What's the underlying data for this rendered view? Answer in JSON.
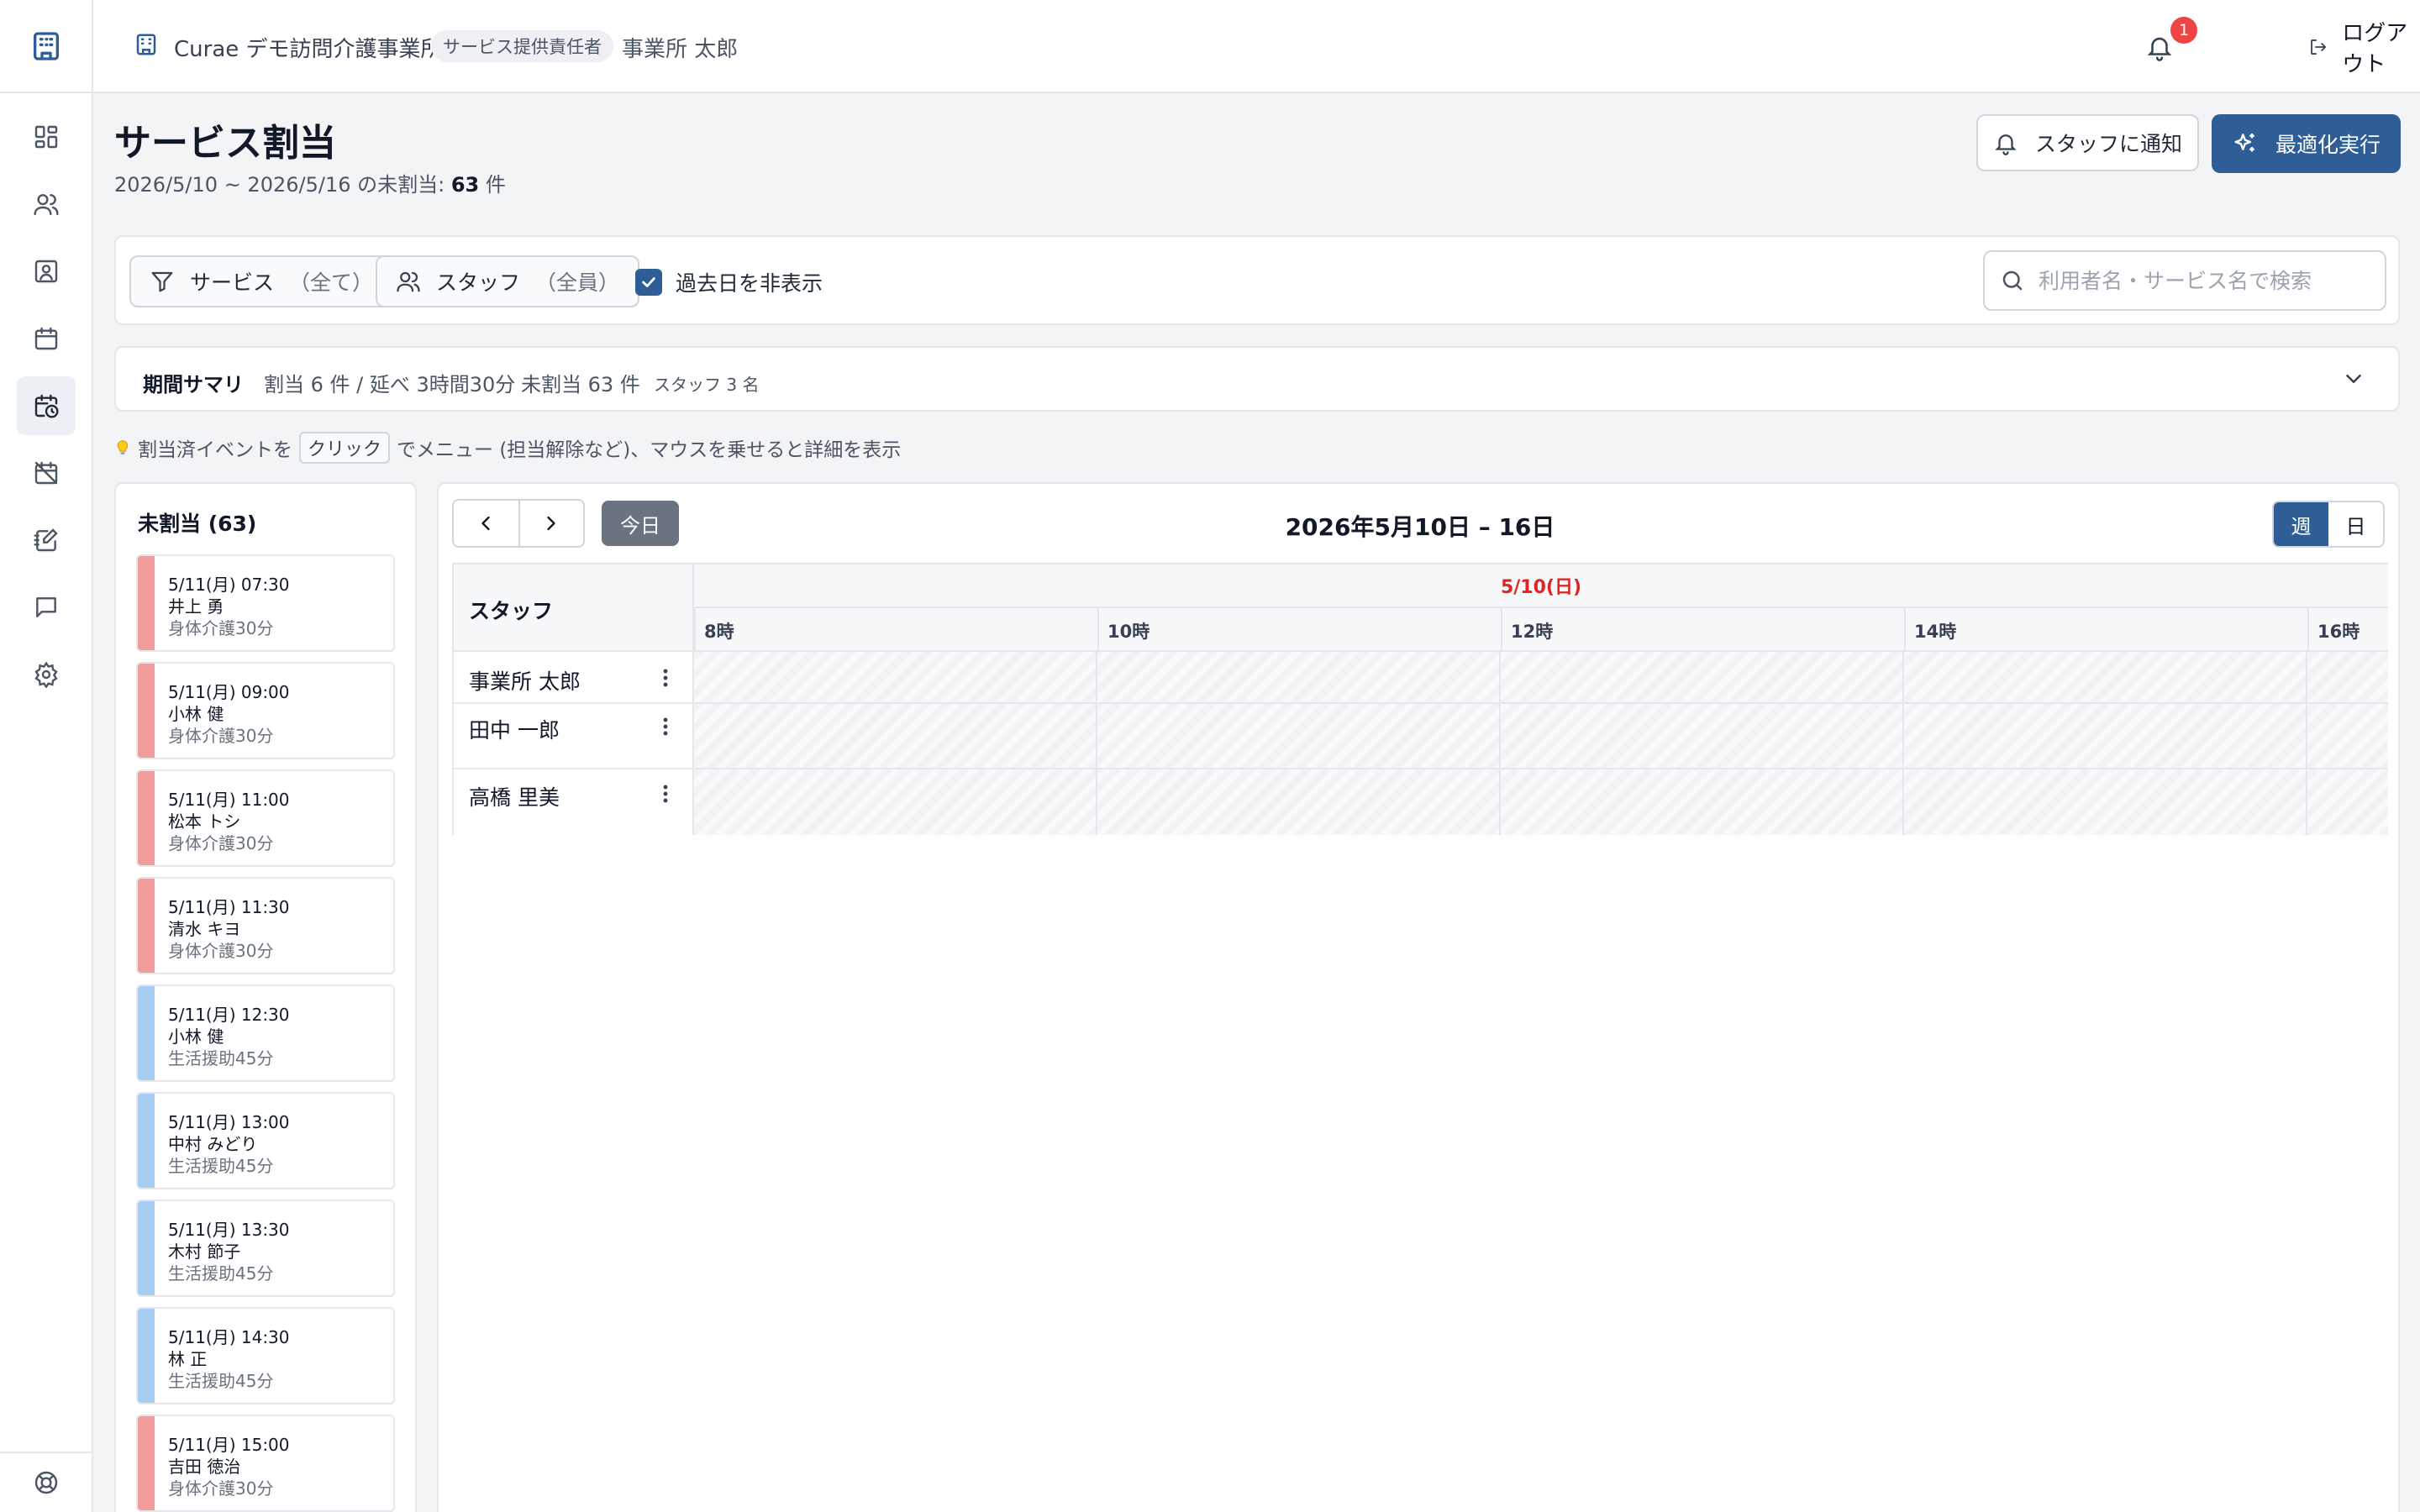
{
  "app": {
    "org_name": "Curae デモ訪問介護事業所",
    "role_badge": "サービス提供責任者",
    "user_name": "事業所 太郎",
    "notification_count": "1",
    "logout_label": "ログアウト"
  },
  "sidebar": {
    "items": [
      {
        "icon": "dashboard-icon"
      },
      {
        "icon": "users-icon"
      },
      {
        "icon": "contact-card-icon"
      },
      {
        "icon": "calendar-icon"
      },
      {
        "icon": "calendar-clock-icon",
        "active": true
      },
      {
        "icon": "calendar-off-icon"
      },
      {
        "icon": "notebook-edit-icon"
      },
      {
        "icon": "message-icon"
      },
      {
        "icon": "gear-icon"
      }
    ],
    "bottom_icon": "help-buoy-icon"
  },
  "page": {
    "title": "サービス割当",
    "subtitle_prefix": "2026/5/10 ~ 2026/5/16 の未割当: ",
    "unassigned_count": "63",
    "subtitle_suffix": " 件",
    "notify_button": "スタッフに通知",
    "optimize_button": "最適化実行"
  },
  "filters": {
    "service_label": "サービス",
    "service_value": "（全て）",
    "staff_label": "スタッフ",
    "staff_value": "（全員）",
    "hide_past_label": "過去日を非表示",
    "hide_past_checked": true,
    "search_placeholder": "利用者名・サービス名で検索",
    "search_value": ""
  },
  "summary": {
    "title": "期間サマリ",
    "assigned": "割当 6 件 / 延べ 3時間30分",
    "unassigned": "未割当 63 件",
    "staff": "スタッフ 3 名"
  },
  "hint": {
    "prefix": "割当済イベントを",
    "key": "クリック",
    "suffix": "でメニュー (担当解除など)、マウスを乗せると詳細を表示"
  },
  "unassigned_panel": {
    "title": "未割当 (63)",
    "cards": [
      {
        "time": "5/11(月) 07:30",
        "name": "井上 勇",
        "service": "身体介護30分",
        "color": "#f29c9c"
      },
      {
        "time": "5/11(月) 09:00",
        "name": "小林 健",
        "service": "身体介護30分",
        "color": "#f29c9c"
      },
      {
        "time": "5/11(月) 11:00",
        "name": "松本 トシ",
        "service": "身体介護30分",
        "color": "#f29c9c"
      },
      {
        "time": "5/11(月) 11:30",
        "name": "清水 キヨ",
        "service": "身体介護30分",
        "color": "#f29c9c"
      },
      {
        "time": "5/11(月) 12:30",
        "name": "小林 健",
        "service": "生活援助45分",
        "color": "#a8cdf2"
      },
      {
        "time": "5/11(月) 13:00",
        "name": "中村 みどり",
        "service": "生活援助45分",
        "color": "#a8cdf2"
      },
      {
        "time": "5/11(月) 13:30",
        "name": "木村 節子",
        "service": "生活援助45分",
        "color": "#a8cdf2"
      },
      {
        "time": "5/11(月) 14:30",
        "name": "林 正",
        "service": "生活援助45分",
        "color": "#a8cdf2"
      },
      {
        "time": "5/11(月) 15:00",
        "name": "吉田 徳治",
        "service": "身体介護30分",
        "color": "#f29c9c"
      }
    ]
  },
  "calendar": {
    "today_label": "今日",
    "range_title": "2026年5月10日 – 16日",
    "view_week": "週",
    "view_day": "日",
    "active_view": "週",
    "staff_header": "スタッフ",
    "day_label": "5/10(日)",
    "hours": [
      "8時",
      "10時",
      "12時",
      "14時",
      "16時"
    ],
    "staff": [
      "事業所 太郎",
      "田中 一郎",
      "高橋 里美"
    ]
  },
  "colors": {
    "primary": "#2f5e96",
    "body_care": "#f29c9c",
    "life_support": "#a8cdf2",
    "sunday_red": "#dc2626",
    "badge_red": "#ef4444"
  }
}
